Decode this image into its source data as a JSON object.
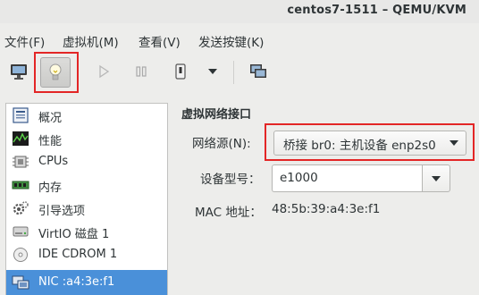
{
  "window": {
    "title": "centos7-1511 – QEMU/KVM"
  },
  "menu": [
    {
      "label": "文件(F)"
    },
    {
      "label": "虚拟机(M)"
    },
    {
      "label": "查看(V)"
    },
    {
      "label": "发送按键(K)"
    }
  ],
  "toolbar": {
    "buttons": [
      "monitor-icon",
      "lightbulb-icon",
      "play-icon",
      "pause-icon",
      "power-icon",
      "chevron-down-icon",
      "screens-icon"
    ]
  },
  "hardware_list": [
    {
      "label": "概况",
      "icon": "overview-icon"
    },
    {
      "label": "性能",
      "icon": "performance-icon"
    },
    {
      "label": "CPUs",
      "icon": "cpu-icon"
    },
    {
      "label": "内存",
      "icon": "memory-icon"
    },
    {
      "label": "引导选项",
      "icon": "boot-options-icon"
    },
    {
      "label": "VirtIO 磁盘 1",
      "icon": "disk-icon"
    },
    {
      "label": "IDE CDROM 1",
      "icon": "cdrom-icon"
    },
    {
      "label": "NIC :a4:3e:f1",
      "icon": "nic-icon",
      "selected": true
    }
  ],
  "detail": {
    "section_title": "虚拟网络接口",
    "source_label": "网络源(N):",
    "source_value": "桥接 br0: 主机设备 enp2s0",
    "model_label": "设备型号：",
    "model_value": "e1000",
    "mac_label": "MAC 地址：",
    "mac_value": "48:5b:39:a4:3e:f1"
  },
  "colors": {
    "selection": "#4a90d9",
    "highlight": "#e32626"
  }
}
